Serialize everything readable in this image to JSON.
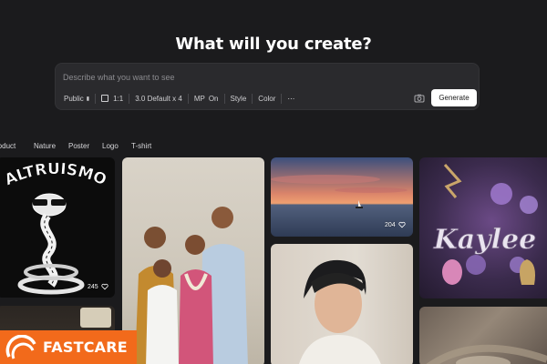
{
  "headline": "What will you create?",
  "prompt": {
    "placeholder": "Describe what you want to see",
    "options": {
      "visibility": "Public",
      "aspect_ratio": "1:1",
      "model": "3.0 Default x 4",
      "magic_prompt_label": "MP",
      "magic_prompt_value": "On",
      "style": "Style",
      "color": "Color",
      "more": "⋯"
    },
    "generate_label": "Generate"
  },
  "categories": [
    "roduct",
    "Nature",
    "Poster",
    "Logo",
    "T-shirt"
  ],
  "gallery": {
    "altruismo": {
      "title_text": "ALTRUISMO",
      "likes": "245"
    },
    "sunset": {
      "likes": "204"
    },
    "kaylee": {
      "title_text": "Kaylee"
    }
  },
  "watermark": {
    "text": "FASTCARE"
  },
  "colors": {
    "background": "#1b1b1d",
    "panel": "#2a2a2d",
    "watermark": "#f26a1b",
    "generate_bg": "#ffffff"
  }
}
